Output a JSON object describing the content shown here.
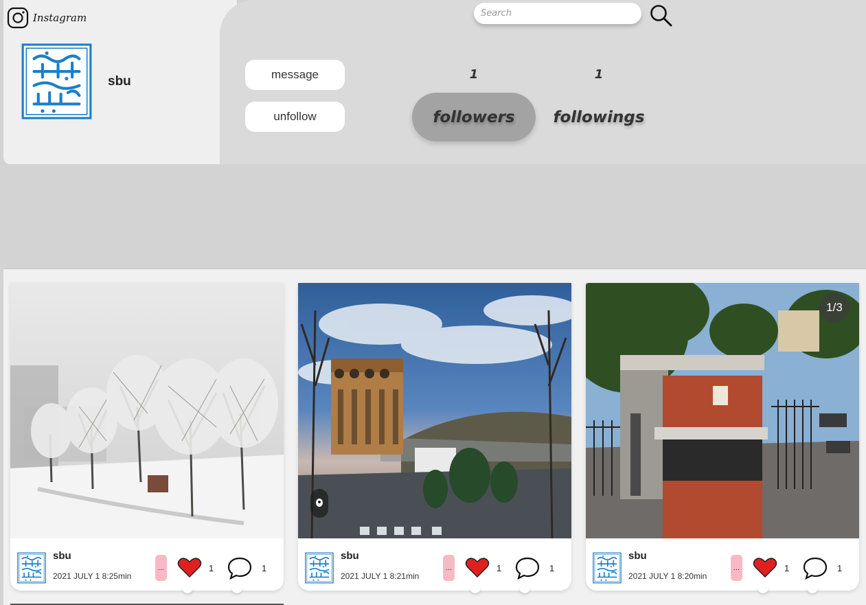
{
  "app": {
    "name": "Instagram"
  },
  "profile": {
    "username": "sbu",
    "avatar_icon": "sbu-logo-icon",
    "message_label": "message",
    "unfollow_label": "unfollow",
    "followers_count": "1",
    "followers_label": "followers",
    "followings_count": "1",
    "followings_label": "followings"
  },
  "search": {
    "placeholder": "Search"
  },
  "colors": {
    "logo_blue": "#1a7fc8",
    "like_red": "#e02020",
    "more_pink": "#f8b9c4",
    "active_stat": "#a3a3a3"
  },
  "posts": [
    {
      "user": "sbu",
      "date": "2021 JULY 1 8:25min",
      "more_label": "...",
      "likes": "1",
      "comments": "1",
      "image": "snowy-campus-photo"
    },
    {
      "user": "sbu",
      "date": "2021 JULY 1 8:21min",
      "more_label": "...",
      "likes": "1",
      "comments": "1",
      "image": "campus-building-skyline-photo"
    },
    {
      "user": "sbu",
      "date": "2021 JULY 1 8:20min",
      "more_label": "...",
      "likes": "1",
      "comments": "1",
      "image": "university-gate-photo",
      "gallery_counter": "1/3"
    }
  ]
}
